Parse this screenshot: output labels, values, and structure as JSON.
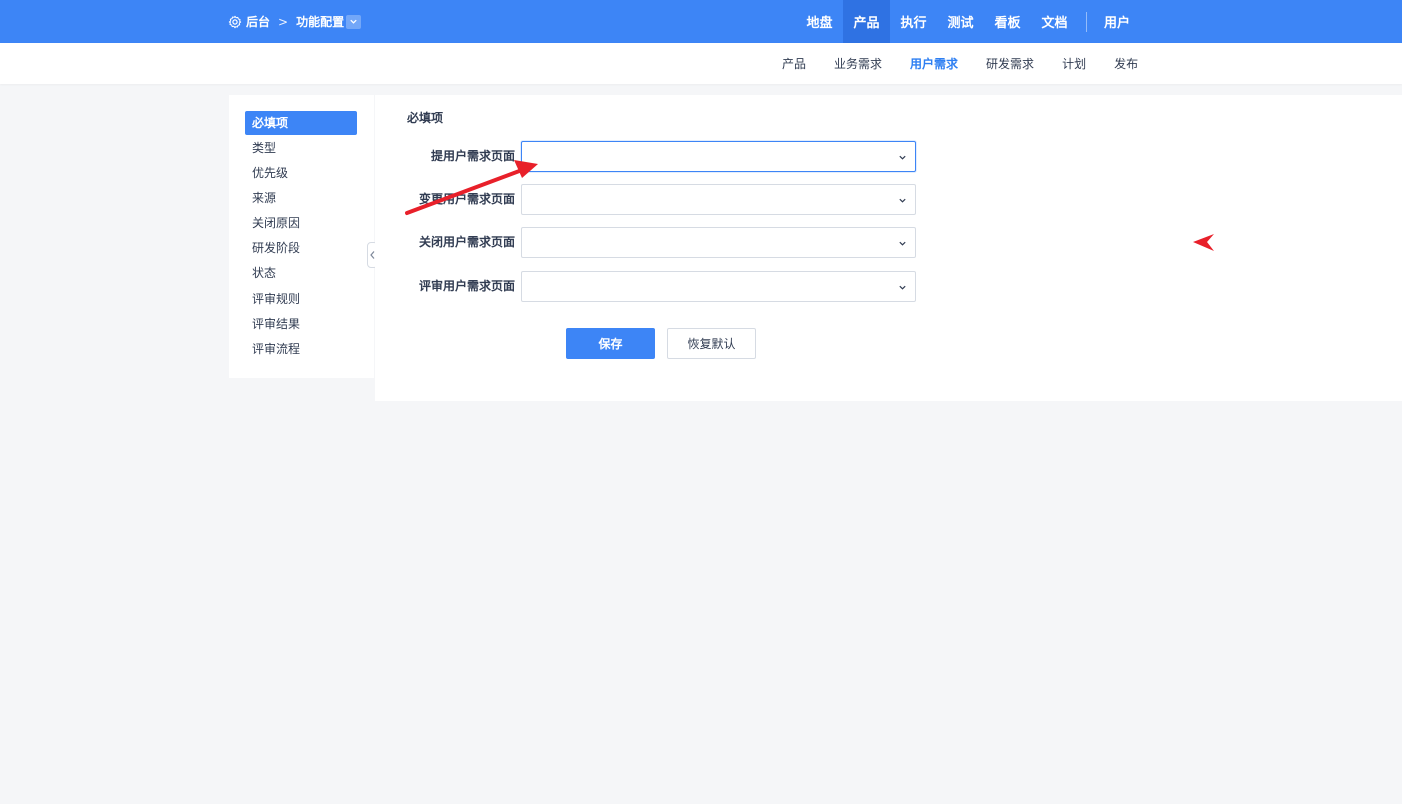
{
  "topbar": {
    "breadcrumb": {
      "root": "后台",
      "current": "功能配置"
    },
    "nav": [
      {
        "label": "地盘",
        "active": false
      },
      {
        "label": "产品",
        "active": true
      },
      {
        "label": "执行",
        "active": false
      },
      {
        "label": "测试",
        "active": false
      },
      {
        "label": "看板",
        "active": false
      },
      {
        "label": "文档",
        "active": false
      }
    ],
    "user_label": "用户"
  },
  "subnav": [
    {
      "label": "产品",
      "active": false
    },
    {
      "label": "业务需求",
      "active": false
    },
    {
      "label": "用户需求",
      "active": true
    },
    {
      "label": "研发需求",
      "active": false
    },
    {
      "label": "计划",
      "active": false
    },
    {
      "label": "发布",
      "active": false
    }
  ],
  "sidebar": [
    {
      "label": "必填项",
      "active": true
    },
    {
      "label": "类型"
    },
    {
      "label": "优先级"
    },
    {
      "label": "来源"
    },
    {
      "label": "关闭原因"
    },
    {
      "label": "研发阶段"
    },
    {
      "label": "状态"
    },
    {
      "label": "评审规则"
    },
    {
      "label": "评审结果"
    },
    {
      "label": "评审流程"
    }
  ],
  "form": {
    "title": "必填项",
    "fields": [
      {
        "label": "提用户需求页面",
        "value": ""
      },
      {
        "label": "变更用户需求页面",
        "value": ""
      },
      {
        "label": "关闭用户需求页面",
        "value": ""
      },
      {
        "label": "评审用户需求页面",
        "value": ""
      }
    ],
    "save_label": "保存",
    "reset_label": "恢复默认"
  },
  "colors": {
    "primary": "#3d85f6",
    "annotation": "#e8202a"
  }
}
